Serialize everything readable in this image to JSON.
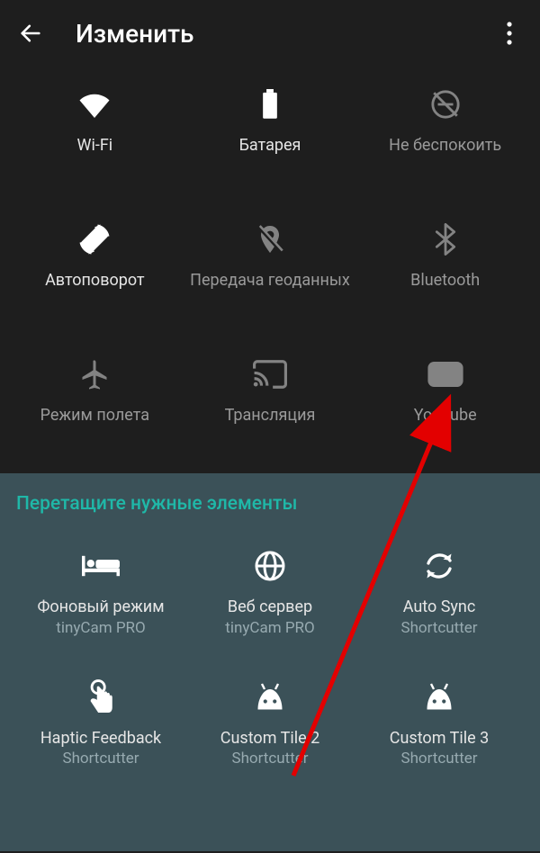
{
  "header": {
    "title": "Изменить"
  },
  "active_tiles": [
    {
      "icon": "wifi",
      "label": "Wi-Fi",
      "dim": false
    },
    {
      "icon": "battery",
      "label": "Батарея",
      "dim": false
    },
    {
      "icon": "dnd",
      "label": "Не беспокоить",
      "dim": true
    },
    {
      "icon": "autorotate",
      "label": "Автоповорот",
      "dim": false
    },
    {
      "icon": "location",
      "label": "Передача геоданных",
      "dim": true
    },
    {
      "icon": "bluetooth",
      "label": "Bluetooth",
      "dim": true
    },
    {
      "icon": "airplane",
      "label": "Режим полета",
      "dim": true
    },
    {
      "icon": "cast",
      "label": "Трансляция",
      "dim": true
    },
    {
      "icon": "youtube",
      "label": "YouTube",
      "dim": true
    }
  ],
  "drag_hint": "Перетащите нужные элементы",
  "available_tiles": [
    {
      "icon": "bed",
      "label": "Фоновый режим",
      "sub": "tinyCam PRO"
    },
    {
      "icon": "globe",
      "label": "Веб сервер",
      "sub": "tinyCam PRO"
    },
    {
      "icon": "sync",
      "label": "Auto Sync",
      "sub": "Shortcutter"
    },
    {
      "icon": "touch",
      "label": "Haptic Feedback",
      "sub": "Shortcutter"
    },
    {
      "icon": "android",
      "label": "Custom Tile 2",
      "sub": "Shortcutter"
    },
    {
      "icon": "android",
      "label": "Custom Tile 3",
      "sub": "Shortcutter"
    }
  ]
}
